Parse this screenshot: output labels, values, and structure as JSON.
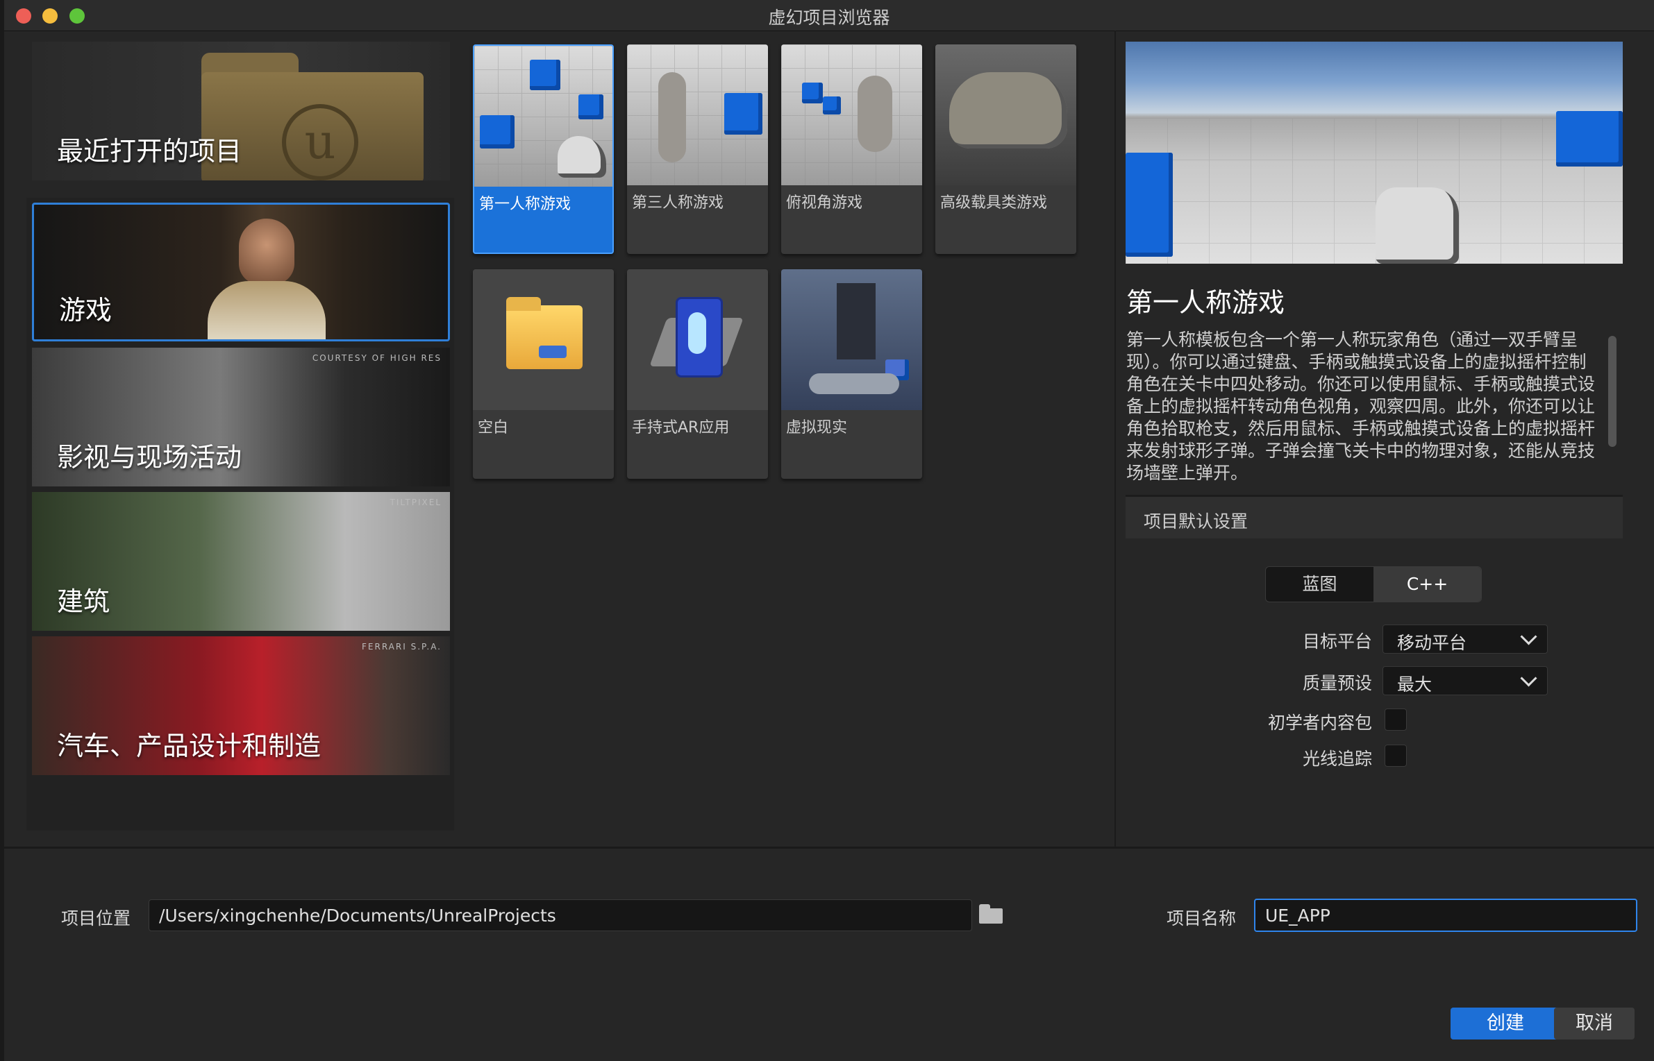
{
  "window": {
    "title": "虚幻项目浏览器"
  },
  "categories": {
    "recent": {
      "label": "最近打开的项目"
    },
    "items": [
      {
        "label": "游戏",
        "credit": ""
      },
      {
        "label": "影视与现场活动",
        "credit": "COURTESY OF HIGH RES"
      },
      {
        "label": "建筑",
        "credit": "TILTPIXEL"
      },
      {
        "label": "汽车、产品设计和制造",
        "credit": "FERRARI S.P.A."
      }
    ]
  },
  "templates": [
    {
      "label": "第一人称游戏",
      "selected": true
    },
    {
      "label": "第三人称游戏"
    },
    {
      "label": "俯视角游戏"
    },
    {
      "label": "高级载具类游戏"
    },
    {
      "label": "空白"
    },
    {
      "label": "手持式AR应用"
    },
    {
      "label": "虚拟现实"
    }
  ],
  "details": {
    "title": "第一人称游戏",
    "description": "第一人称模板包含一个第一人称玩家角色（通过一双手臂呈现）。你可以通过键盘、手柄或触摸式设备上的虚拟摇杆控制角色在关卡中四处移动。你还可以使用鼠标、手柄或触摸式设备上的虚拟摇杆转动角色视角，观察四周。此外，你还可以让角色拾取枪支，然后用鼠标、手柄或触摸式设备上的虚拟摇杆来发射球形子弹。子弹会撞飞关卡中的物理对象，还能从竞技场墙壁上弹开。",
    "defaults_header": "项目默认设置",
    "toggle": {
      "options": [
        "蓝图",
        "C++"
      ],
      "selected": "C++"
    },
    "target_platform": {
      "label": "目标平台",
      "value": "移动平台"
    },
    "quality_preset": {
      "label": "质量预设",
      "value": "最大"
    },
    "starter_content": {
      "label": "初学者内容包",
      "checked": false
    },
    "raytracing": {
      "label": "光线追踪",
      "checked": false
    }
  },
  "footer": {
    "location_label": "项目位置",
    "location_value": "/Users/xingchenhe/Documents/UnrealProjects",
    "name_label": "项目名称",
    "name_value": "UE_APP",
    "create": "创建",
    "cancel": "取消"
  },
  "colors": {
    "accent": "#1d6fd6",
    "selected_tile": "#1b72d9",
    "window_bg": "#262626"
  }
}
